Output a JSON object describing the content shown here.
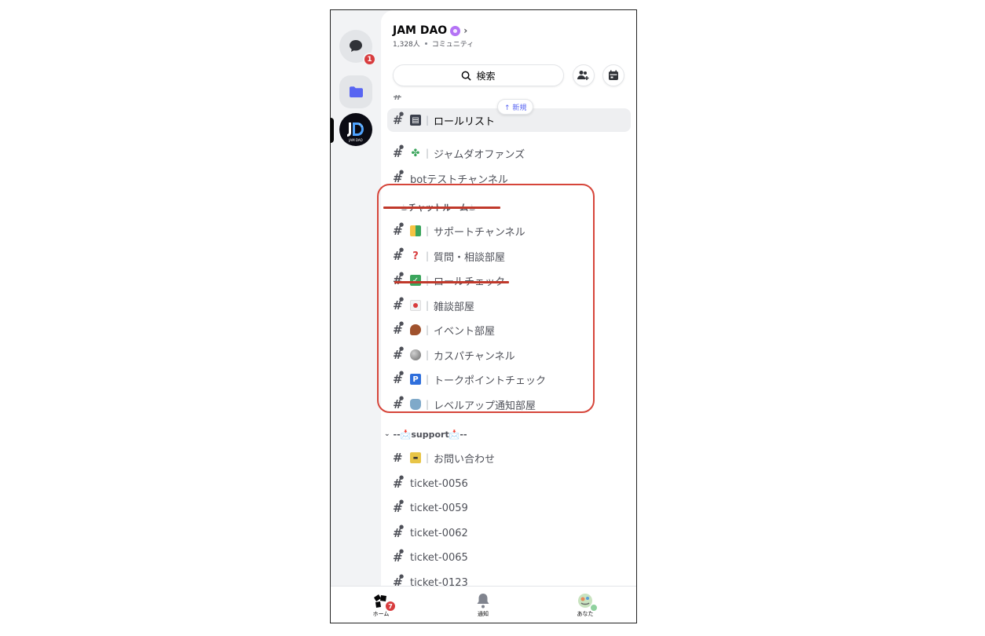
{
  "server": {
    "name": "JAM DAO",
    "members": "1,328人",
    "type": "コミュニティ",
    "search_label": "検索"
  },
  "rail": {
    "dm_badge": "1",
    "server_logo_text": "JAM DAO"
  },
  "channels_top": [
    {
      "emoji": "book-icon",
      "sep": "|",
      "name": "ロールリスト",
      "active": true
    },
    {
      "emoji": "clover-icon",
      "sep": "|",
      "name": "ジャムダオファンズ"
    },
    {
      "emoji": "",
      "sep": "",
      "name": "botテストチャンネル"
    }
  ],
  "new_pill": "↑ 新規",
  "category_chat": {
    "label": "--☕チャットルーム☕--"
  },
  "channels_chat": [
    {
      "emoji": "beginner-icon",
      "name": "サポートチャンネル"
    },
    {
      "emoji": "question-icon",
      "name": "質問・相談部屋"
    },
    {
      "emoji": "check-icon",
      "name": "ロールチェック"
    },
    {
      "emoji": "japan-flag-icon",
      "name": "雑談部屋"
    },
    {
      "emoji": "meat-icon",
      "name": "イベント部屋"
    },
    {
      "emoji": "moon-icon",
      "name": "カスパチャンネル"
    },
    {
      "emoji": "parking-icon",
      "name": "トークポイントチェック"
    },
    {
      "emoji": "pot-icon",
      "name": "レベルアップ通知部屋"
    }
  ],
  "category_support": {
    "label": "--📩support📩--"
  },
  "channels_support": [
    {
      "emoji": "ticket-icon",
      "name": "お問い合わせ",
      "sep": "|"
    },
    {
      "name": "ticket-0056"
    },
    {
      "name": "ticket-0059"
    },
    {
      "name": "ticket-0062"
    },
    {
      "name": "ticket-0065"
    },
    {
      "name": "ticket-0123"
    }
  ],
  "tabs": {
    "home": "ホーム",
    "home_badge": "7",
    "notifications": "通知",
    "you": "あなた"
  },
  "colors": {
    "highlight": "#d6453a",
    "accent": "#5865f2",
    "badge": "#d83c3e"
  }
}
